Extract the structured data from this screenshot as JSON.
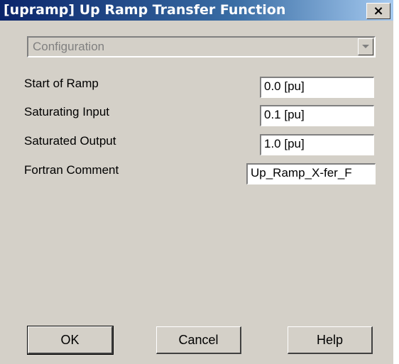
{
  "window": {
    "title": "[upramp] Up Ramp Transfer Function",
    "close_glyph": "×"
  },
  "configuration": {
    "selected": "Configuration"
  },
  "properties": [
    {
      "label": "Start of Ramp",
      "value": "0.0 [pu]"
    },
    {
      "label": "Saturating Input",
      "value": "0.1 [pu]"
    },
    {
      "label": "Saturated Output",
      "value": "1.0 [pu]"
    },
    {
      "label": "Fortran Comment",
      "value": "Up_Ramp_X-fer_F"
    }
  ],
  "buttons": {
    "ok": "OK",
    "cancel": "Cancel",
    "help": "Help"
  }
}
